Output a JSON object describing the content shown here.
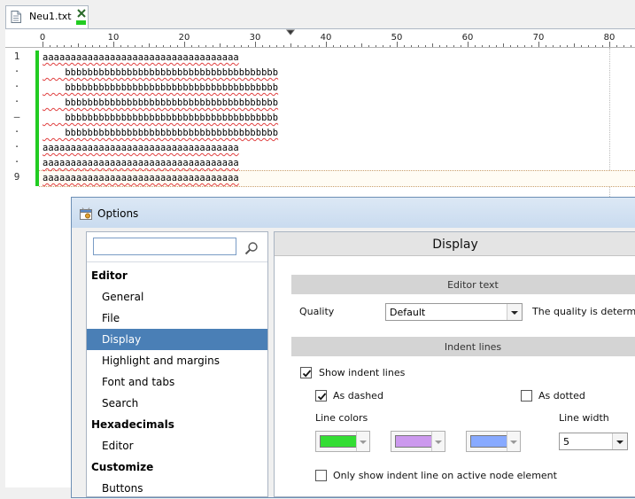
{
  "tab": {
    "title": "Neu1.txt"
  },
  "ruler": {
    "labels": [
      "0",
      "10",
      "20",
      "30",
      "40",
      "50",
      "60",
      "70",
      "80"
    ]
  },
  "gutter": {
    "labels": [
      "1",
      "·",
      "·",
      "·",
      "–",
      "·",
      "·",
      "·",
      "9"
    ]
  },
  "editor": {
    "lines": [
      "aaaaaaaaaaaaaaaaaaaaaaaaaaaaaaaaaaa",
      "    bbbbbbbbbbbbbbbbbbbbbbbbbbbbbbbbbbbbbb",
      "    bbbbbbbbbbbbbbbbbbbbbbbbbbbbbbbbbbbbbb",
      "    bbbbbbbbbbbbbbbbbbbbbbbbbbbbbbbbbbbbbb",
      "    bbbbbbbbbbbbbbbbbbbbbbbbbbbbbbbbbbbbbb",
      "    bbbbbbbbbbbbbbbbbbbbbbbbbbbbbbbbbbbbbb",
      "aaaaaaaaaaaaaaaaaaaaaaaaaaaaaaaaaaa",
      "aaaaaaaaaaaaaaaaaaaaaaaaaaaaaaaaaaa",
      "aaaaaaaaaaaaaaaaaaaaaaaaaaaaaaaaaaa"
    ]
  },
  "dialog": {
    "title": "Options",
    "search": {
      "value": "",
      "placeholder": ""
    },
    "nav": [
      {
        "label": "Editor",
        "kind": "group"
      },
      {
        "label": "General",
        "kind": "item"
      },
      {
        "label": "File",
        "kind": "item"
      },
      {
        "label": "Display",
        "kind": "item",
        "selected": true
      },
      {
        "label": "Highlight and margins",
        "kind": "item"
      },
      {
        "label": "Font and tabs",
        "kind": "item"
      },
      {
        "label": "Search",
        "kind": "item"
      },
      {
        "label": "Hexadecimals",
        "kind": "group"
      },
      {
        "label": "Editor",
        "kind": "item"
      },
      {
        "label": "Customize",
        "kind": "group"
      },
      {
        "label": "Buttons",
        "kind": "item"
      }
    ],
    "panel": {
      "header": "Display",
      "editor_text": {
        "section": "Editor text",
        "quality_label": "Quality",
        "quality_value": "Default",
        "quality_hint": "The quality is determined"
      },
      "indent_lines": {
        "section": "Indent lines",
        "show_indent_lines": {
          "label": "Show indent lines",
          "checked": true
        },
        "as_dashed": {
          "label": "As dashed",
          "checked": true
        },
        "as_dotted": {
          "label": "As dotted",
          "checked": false
        },
        "line_colors_label": "Line colors",
        "line_colors": [
          "#33dd33",
          "#cc99ee",
          "#88aaff"
        ],
        "line_width_label": "Line width",
        "line_width_value": "5",
        "only_active": {
          "label": "Only show indent line on active node element",
          "checked": false
        }
      }
    }
  },
  "colors": {
    "selection": "#4a7fb6",
    "change_bar": "#22cc22",
    "spell_underline": "#e04040"
  }
}
